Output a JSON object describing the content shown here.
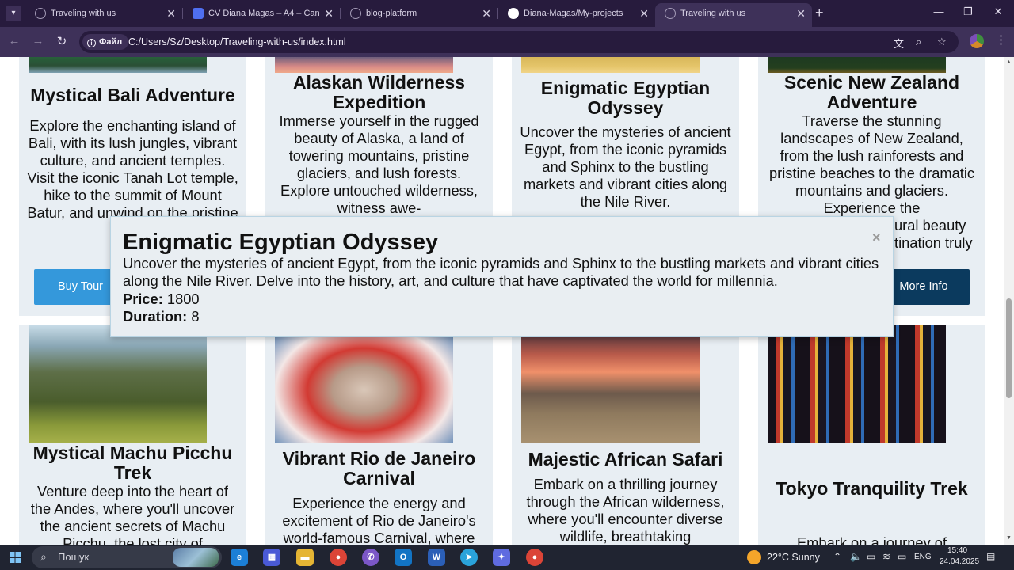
{
  "browser": {
    "tabs": [
      {
        "title": "Traveling with us",
        "icon": "globe-icon"
      },
      {
        "title": "CV Diana Magas – A4 – Canva",
        "icon": "canva-icon"
      },
      {
        "title": "blog-platform",
        "icon": "globe-icon"
      },
      {
        "title": "Diana-Magas/My-projects",
        "icon": "github-icon"
      },
      {
        "title": "Traveling with us",
        "icon": "globe-icon",
        "active": true
      }
    ],
    "new_tab": "+",
    "close_glyph": "✕",
    "chip_label": "Файл",
    "url": "C:/Users/Sz/Desktop/Traveling-with-us/index.html"
  },
  "tours": [
    {
      "title": "Mystical Bali Adventure",
      "desc": "Explore the enchanting island of Bali, with its lush jungles, vibrant culture, and ancient temples. Visit the iconic Tanah Lot temple, hike to the summit of Mount Batur, and unwind on the pristine"
    },
    {
      "title": "Alaskan Wilderness Expedition",
      "desc": "Immerse yourself in the rugged beauty of Alaska, a land of towering mountains, pristine glaciers, and lush forests. Explore untouched wilderness, witness awe-"
    },
    {
      "title": "Enigmatic Egyptian Odyssey",
      "desc": "Uncover the mysteries of ancient Egypt, from the iconic pyramids and Sphinx to the bustling markets and vibrant cities along the Nile River."
    },
    {
      "title": "Scenic New Zealand Adventure",
      "desc": "Traverse the stunning landscapes of New Zealand, from the lush rainforests and pristine beaches to the dramatic mountains and glaciers. Experience the",
      "desc_tail_1": "ural beauty",
      "desc_tail_2": "tination truly"
    },
    {
      "title": "Mystical Machu Picchu Trek",
      "desc": "Venture deep into the heart of the Andes, where you'll uncover the ancient secrets of Machu Picchu, the lost city of"
    },
    {
      "title": "Vibrant Rio de Janeiro Carnival",
      "desc": "Experience the energy and excitement of Rio de Janeiro's world-famous Carnival, where"
    },
    {
      "title": "Majestic African Safari",
      "desc": "Embark on a thrilling journey through the African wilderness, where you'll encounter diverse wildlife, breathtaking"
    },
    {
      "title": "Tokyo Tranquility Trek",
      "desc": "Embark on a journey of"
    }
  ],
  "buttons": {
    "buy": "Buy Tour",
    "more": "More Info"
  },
  "modal": {
    "title": "Enigmatic Egyptian Odyssey",
    "close": "×",
    "description": "Uncover the mysteries of ancient Egypt, from the iconic pyramids and Sphinx to the bustling markets and vibrant cities along the Nile River. Delve into the history, art, and culture that have captivated the world for millennia.",
    "price_label": "Price:",
    "price": "1800",
    "duration_label": "Duration:",
    "duration": "8"
  },
  "taskbar": {
    "search_placeholder": "Пошук",
    "weather": "22°C  Sunny",
    "lang": "ENG",
    "time": "15:40",
    "date": "24.04.2025"
  },
  "colors": {
    "buy_button": "#3498db",
    "more_button": "#0b3a5e",
    "card_bg": "#e8eef3",
    "tab_bar": "#271b3d"
  }
}
